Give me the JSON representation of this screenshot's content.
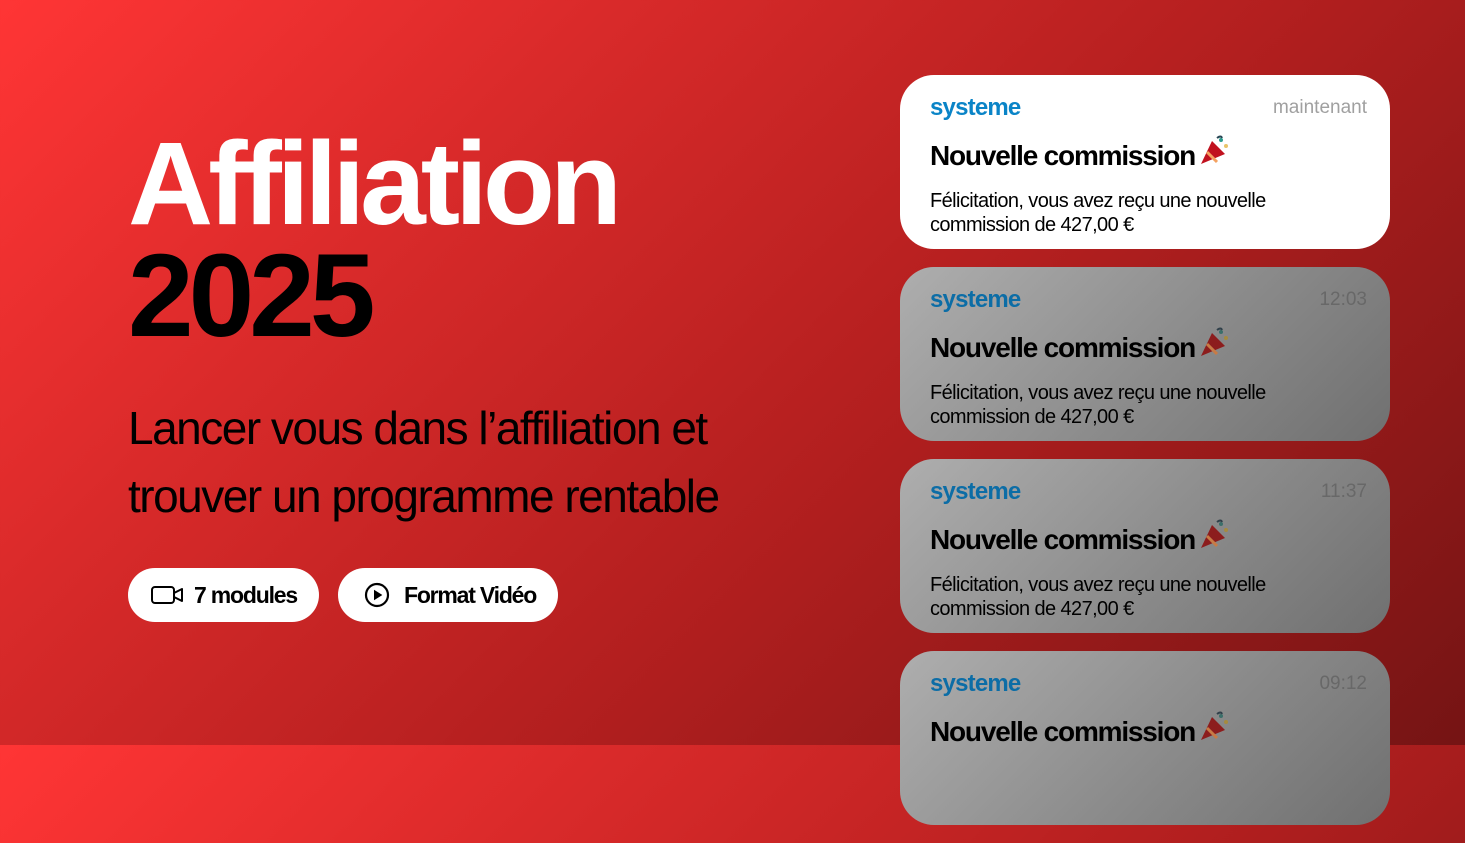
{
  "hero": {
    "title": "Affiliation",
    "year": "2025",
    "subtitle": "Lancer vous dans l’affiliation et trouver un programme rentable"
  },
  "badges": [
    {
      "icon": "video-camera-icon",
      "label": "7 modules"
    },
    {
      "icon": "play-circle-icon",
      "label": "Format Vidéo"
    }
  ],
  "notifications": [
    {
      "brand": "systeme",
      "time": "maintenant",
      "title": "Nouvelle commission",
      "icon": "party-popper-icon",
      "body": "Félicitation, vous avez reçu une nouvelle commission de 427,00 €"
    },
    {
      "brand": "systeme",
      "time": "12:03",
      "title": "Nouvelle commission",
      "icon": "party-popper-icon",
      "body": "Félicitation, vous avez reçu une nouvelle commission de 427,00 €"
    },
    {
      "brand": "systeme",
      "time": "11:37",
      "title": "Nouvelle commission",
      "icon": "party-popper-icon",
      "body": "Félicitation, vous avez reçu une nouvelle commission de 427,00 €"
    },
    {
      "brand": "systeme",
      "time": "09:12",
      "title": "Nouvelle commission",
      "icon": "party-popper-icon"
    }
  ],
  "colors": {
    "background_start": "#ff3535",
    "background_end": "#751414",
    "brand_blue": "#0a84c7",
    "white": "#ffffff",
    "black": "#000000"
  }
}
